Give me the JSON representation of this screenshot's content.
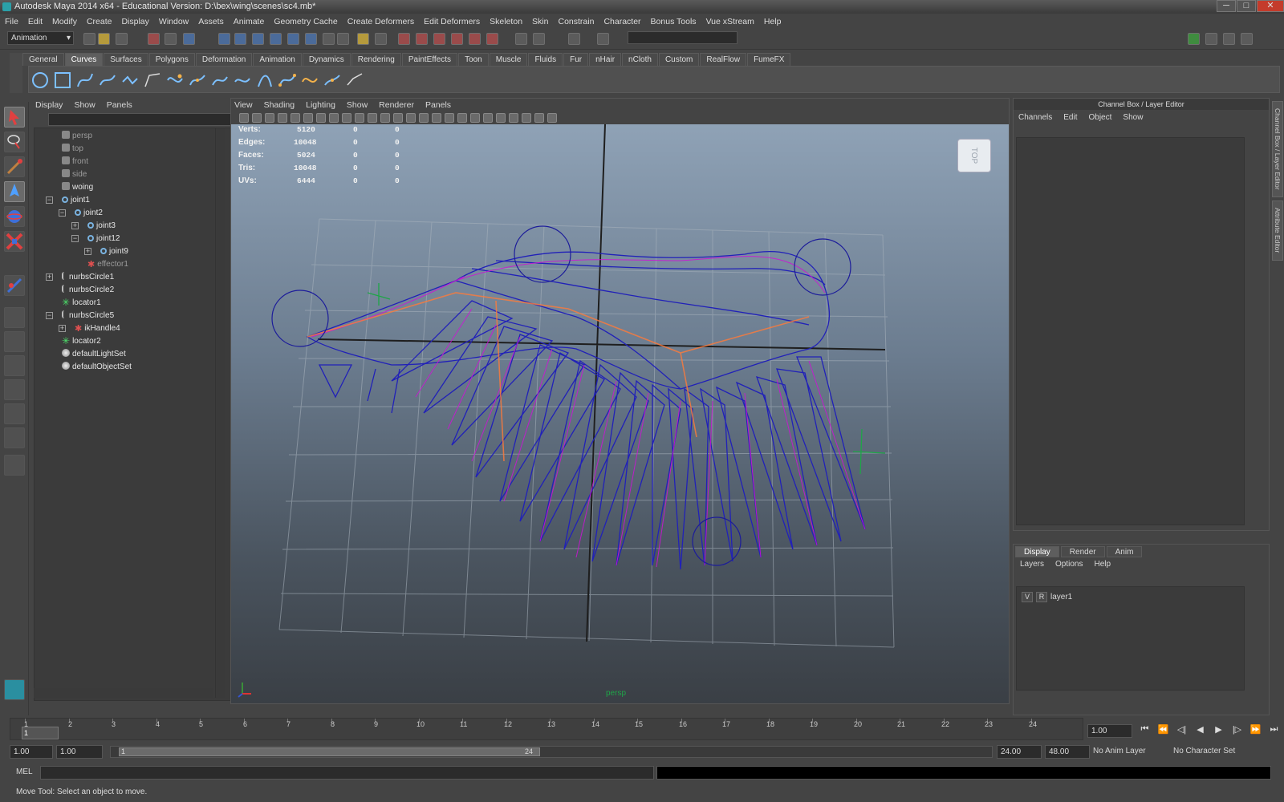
{
  "window": {
    "title": "Autodesk Maya 2014 x64 - Educational Version: D:\\bex\\wing\\scenes\\sc4.mb*",
    "controls": [
      "─",
      "□",
      "✕"
    ]
  },
  "menubar": [
    "File",
    "Edit",
    "Modify",
    "Create",
    "Display",
    "Window",
    "Assets",
    "Animate",
    "Geometry Cache",
    "Create Deformers",
    "Edit Deformers",
    "Skeleton",
    "Skin",
    "Constrain",
    "Character",
    "Bonus Tools",
    "Vue xStream",
    "Help"
  ],
  "statusline": {
    "mode": "Animation"
  },
  "shelf": {
    "tabs": [
      "General",
      "Curves",
      "Surfaces",
      "Polygons",
      "Deformation",
      "Animation",
      "Dynamics",
      "Rendering",
      "PaintEffects",
      "Toon",
      "Muscle",
      "Fluids",
      "Fur",
      "nHair",
      "nCloth",
      "Custom",
      "RealFlow",
      "FumeFX"
    ],
    "active": "Curves"
  },
  "outliner": {
    "menu": [
      "Display",
      "Show",
      "Panels"
    ],
    "items": [
      {
        "label": "persp",
        "icon": "camera-icon",
        "dim": true
      },
      {
        "label": "top",
        "icon": "camera-icon",
        "dim": true
      },
      {
        "label": "front",
        "icon": "camera-icon",
        "dim": true
      },
      {
        "label": "side",
        "icon": "camera-icon",
        "dim": true
      },
      {
        "label": "woing",
        "icon": "camera-icon",
        "dim": false
      },
      {
        "label": "joint1",
        "icon": "joint-icon",
        "dim": false
      },
      {
        "label": "joint2",
        "icon": "joint-icon",
        "dim": false
      },
      {
        "label": "joint3",
        "icon": "joint-icon",
        "dim": false
      },
      {
        "label": "joint12",
        "icon": "joint-icon",
        "dim": false
      },
      {
        "label": "joint9",
        "icon": "joint-icon",
        "dim": false
      },
      {
        "label": "effector1",
        "icon": "effector-icon",
        "dim": true
      },
      {
        "label": "nurbsCircle1",
        "icon": "curve-icon",
        "dim": false
      },
      {
        "label": "nurbsCircle2",
        "icon": "curve-icon",
        "dim": false
      },
      {
        "label": "locator1",
        "icon": "locator-icon",
        "dim": false
      },
      {
        "label": "nurbsCircle5",
        "icon": "curve-icon",
        "dim": false
      },
      {
        "label": "ikHandle4",
        "icon": "ik-handle-icon",
        "dim": false
      },
      {
        "label": "locator2",
        "icon": "locator-icon",
        "dim": false
      },
      {
        "label": "defaultLightSet",
        "icon": "set-icon",
        "dim": false
      },
      {
        "label": "defaultObjectSet",
        "icon": "set-icon",
        "dim": false
      }
    ]
  },
  "viewport": {
    "menu": [
      "View",
      "Shading",
      "Lighting",
      "Show",
      "Renderer",
      "Panels"
    ],
    "hud": {
      "rows": [
        {
          "label": "Verts:",
          "values": [
            "5120",
            "0",
            "0"
          ]
        },
        {
          "label": "Edges:",
          "values": [
            "10048",
            "0",
            "0"
          ]
        },
        {
          "label": "Faces:",
          "values": [
            "5024",
            "0",
            "0"
          ]
        },
        {
          "label": "Tris:",
          "values": [
            "10048",
            "0",
            "0"
          ]
        },
        {
          "label": "UVs:",
          "values": [
            "6444",
            "0",
            "0"
          ]
        }
      ]
    },
    "viewcube_label": "TOP",
    "camera": "persp"
  },
  "channelbox": {
    "title": "Channel Box / Layer Editor",
    "menu": [
      "Channels",
      "Edit",
      "Object",
      "Show"
    ],
    "side_tabs": [
      "Channel Box / Layer Editor",
      "Attribute Editor"
    ]
  },
  "layers": {
    "tabs": [
      "Display",
      "Render",
      "Anim"
    ],
    "active": "Display",
    "menu": [
      "Layers",
      "Options",
      "Help"
    ],
    "rows": [
      {
        "v": "V",
        "r": "R",
        "name": "layer1"
      }
    ]
  },
  "timeline": {
    "ticks": [
      "1",
      "2",
      "3",
      "4",
      "5",
      "6",
      "7",
      "8",
      "9",
      "10",
      "11",
      "12",
      "13",
      "14",
      "15",
      "16",
      "17",
      "18",
      "19",
      "20",
      "21",
      "22",
      "23",
      "24"
    ],
    "current_marker": "1",
    "current_frame": "1.00",
    "playback_buttons": [
      "⏮",
      "⏪",
      "◁|",
      "◀",
      "▶",
      "|▷",
      "⏩",
      "⏭"
    ]
  },
  "range": {
    "start": "1.00",
    "playback_start": "1.00",
    "slider_start": "1",
    "slider_end": "24",
    "playback_end": "24.00",
    "end": "48.00",
    "anim_layer": "No Anim Layer",
    "character_set": "No Character Set"
  },
  "commandline": {
    "label": "MEL"
  },
  "helpline": {
    "text": "Move Tool: Select an object to move."
  }
}
